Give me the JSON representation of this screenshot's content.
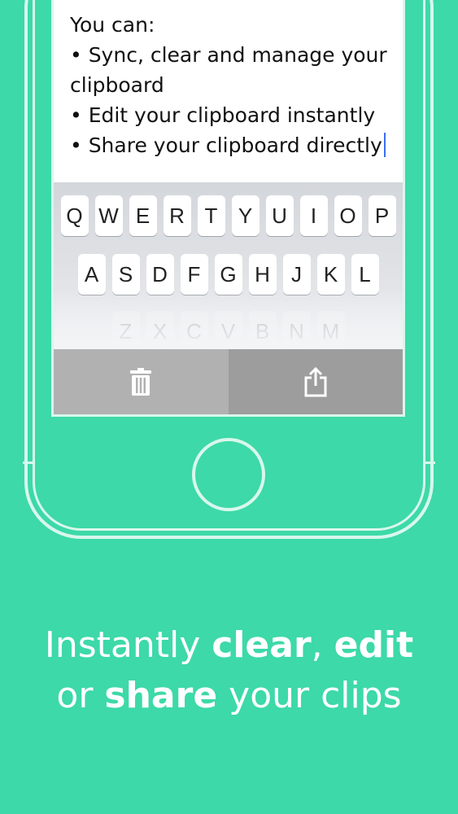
{
  "note": {
    "lines": [
      "You can:",
      "• Sync, clear and manage your",
      "clipboard",
      "• Edit your clipboard instantly",
      "• Share your clipboard directly"
    ]
  },
  "keyboard": {
    "row1": [
      "Q",
      "W",
      "E",
      "R",
      "T",
      "Y",
      "U",
      "I",
      "O",
      "P"
    ],
    "row2": [
      "A",
      "S",
      "D",
      "F",
      "G",
      "H",
      "J",
      "K",
      "L"
    ],
    "row3": [
      "Z",
      "X",
      "C",
      "V",
      "B",
      "N",
      "M"
    ]
  },
  "actions": {
    "delete_icon": "trash-icon",
    "share_icon": "share-icon"
  },
  "tagline": {
    "line1_a": "Instantly ",
    "line1_b": "clear",
    "line1_c": ", ",
    "line1_d": "edit",
    "line2_a": "or ",
    "line2_b": "share",
    "line2_c": " your clips"
  },
  "colors": {
    "background": "#3dd9a8",
    "outline": "#d8f7ec",
    "caret": "#3b6df0",
    "delete_button": "#b1b1b1",
    "share_button": "#9d9d9d"
  }
}
